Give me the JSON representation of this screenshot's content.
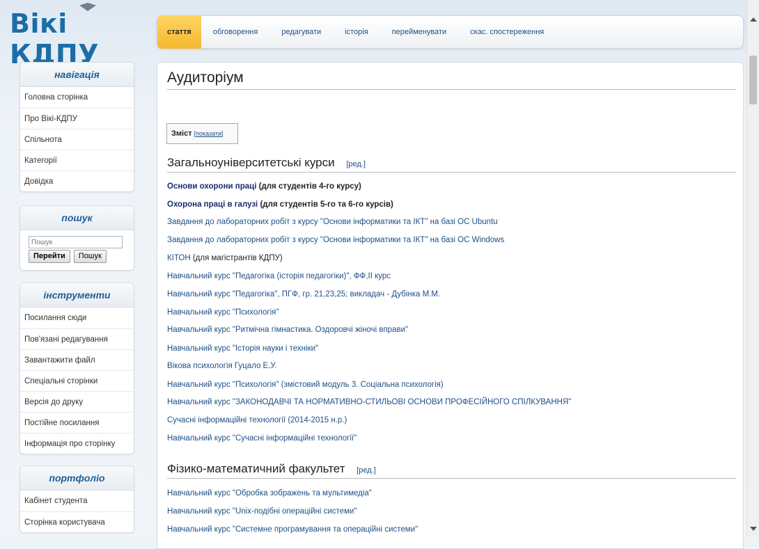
{
  "logo": {
    "text": "Вікі КДПУ"
  },
  "tabs": [
    {
      "label": "стаття",
      "active": true
    },
    {
      "label": "обговорення"
    },
    {
      "label": "редагувати"
    },
    {
      "label": "історія"
    },
    {
      "label": "перейменувати"
    },
    {
      "label": "скас. спостереження"
    }
  ],
  "nav": {
    "title": "навігація",
    "items": [
      "Головна сторінка",
      "Про Вікі-КДПУ",
      "Спільнота",
      "Категорії",
      "Довідка"
    ]
  },
  "search": {
    "title": "пошук",
    "placeholder": "Пошук",
    "go_label": "Перейти",
    "search_label": "Пошук"
  },
  "tools": {
    "title": "інструменти",
    "items": [
      "Посилання сюди",
      "Пов'язані редагування",
      "Завантажити файл",
      "Спеціальні сторінки",
      "Версія до друку",
      "Постійне посилання",
      "Інформація про сторінку"
    ]
  },
  "portfolio": {
    "title": "портфоліо",
    "items": [
      "Кабінет студента",
      "Сторінка користувача"
    ]
  },
  "page": {
    "title": "Аудиторіум",
    "toc_label": "Зміст",
    "toc_toggle": "показати",
    "edit_label": "ред.",
    "sections": [
      {
        "heading": "Загальноуніверситетські курси",
        "entries": [
          {
            "link": "Основи охорони праці",
            "note": " (для студентів 4-го курсу)",
            "bold": true
          },
          {
            "link": "Охорона праці в галузі",
            "note": " (для студентів 5-го та 6-го курсів)",
            "bold": true
          },
          {
            "link": "Завдання до лабораторних робіт з курсу \"Основи інформатики та ІКТ\" на базі ОС Ubuntu",
            "note": ""
          },
          {
            "link": "Завдання до лабораторних робіт з курсу \"Основи інформатики та ІКТ\" на базі ОС Windows",
            "note": ""
          },
          {
            "link": "КІТОН",
            "note": " (для магістрантів КДПУ)"
          },
          {
            "link": "Навчальний курс \"Педагогіка (історія педагогіки)\", ФФ,ІІ курс",
            "note": ""
          },
          {
            "link": "Навчальний курс \"Педагогіка\", ПГФ, гр. 21,23,25; викладач - Дубінка М.М.",
            "note": ""
          },
          {
            "link": "Навчальний курс \"Психологія\"",
            "note": ""
          },
          {
            "link": "Навчальний курс \"Ритмічна гімнастика. Оздоровчі жіночі вправи\"",
            "note": ""
          },
          {
            "link": "Навчальний курс \"Історія науки і техніки\"",
            "note": ""
          },
          {
            "link": "Вікова психологія Гуцало Е.У.",
            "note": ""
          },
          {
            "link": "Навчальний курс \"Психологія\" (змістовий модуль 3. Соціальна психологія)",
            "note": ""
          },
          {
            "link": "Навчальний курс \"ЗАКОНОДАВЧІ ТА НОРМАТИВНО-СТИЛЬОВІ ОСНОВИ ПРОФЕСІЙНОГО СПІЛКУВАННЯ\"",
            "note": ""
          },
          {
            "link": "Сучасні інформаційні технології (2014-2015 н.р.)",
            "note": ""
          },
          {
            "link": "Навчальний курс \"Сучасні інформаційні технології\"",
            "note": ""
          }
        ]
      },
      {
        "heading": "Фізико-математичний факультет",
        "entries": [
          {
            "link": "Навчальний курс \"Обробка зображень та мультимедіа\"",
            "note": ""
          },
          {
            "link": "Навчальний курс \"Unix-подібні операційні системи\"",
            "note": ""
          },
          {
            "link": "Навчальний курс \"Системне програмування та операційні системи\"",
            "note": ""
          }
        ]
      }
    ]
  }
}
